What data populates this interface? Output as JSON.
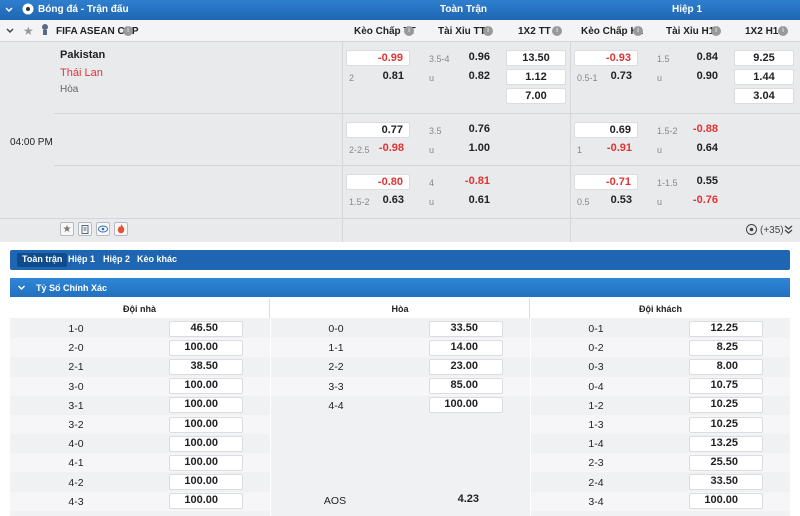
{
  "header": {
    "sport_title": "Bóng đá - Trận đấu",
    "full_match": "Toàn Trận",
    "half1": "Hiệp 1"
  },
  "columns": [
    "Kèo Chấp TT",
    "Tài Xỉu TT",
    "1X2 TT",
    "Kèo Chấp H1",
    "Tài Xỉu H1",
    "1X2 H1"
  ],
  "competition": "FIFA ASEAN CUP",
  "match": {
    "home": "Pakistan",
    "away": "Thái Lan",
    "draw": "Hòa",
    "time": "04:00 PM",
    "more": "(+35)"
  },
  "odds": {
    "r1": {
      "hc_tt_top": "-0.99",
      "hc_tt_lbl": "2",
      "hc_tt_bot": "0.81",
      "ou_tt_lbl_top": "3.5-4",
      "ou_tt_top": "0.96",
      "ou_tt_lbl_bot": "u",
      "ou_tt_bot": "0.82",
      "x_tt_1": "13.50",
      "x_tt_2": "1.12",
      "x_tt_3": "7.00",
      "hc_h1_top": "-0.93",
      "hc_h1_lbl": "0.5-1",
      "hc_h1_bot": "0.73",
      "ou_h1_lbl_top": "1.5",
      "ou_h1_top": "0.84",
      "ou_h1_lbl_bot": "u",
      "ou_h1_bot": "0.90",
      "x_h1_1": "9.25",
      "x_h1_2": "1.44",
      "x_h1_3": "3.04"
    },
    "r2": {
      "hc_tt_top": "0.77",
      "hc_tt_lbl": "2-2.5",
      "hc_tt_bot": "-0.98",
      "ou_tt_lbl_top": "3.5",
      "ou_tt_top": "0.76",
      "ou_tt_lbl_bot": "u",
      "ou_tt_bot": "1.00",
      "hc_h1_top": "0.69",
      "hc_h1_lbl": "1",
      "hc_h1_bot": "-0.91",
      "ou_h1_lbl_top": "1.5-2",
      "ou_h1_top": "-0.88",
      "ou_h1_lbl_bot": "u",
      "ou_h1_bot": "0.64"
    },
    "r3": {
      "hc_tt_top": "-0.80",
      "hc_tt_lbl": "1.5-2",
      "hc_tt_bot": "0.63",
      "ou_tt_lbl_top": "4",
      "ou_tt_top": "-0.81",
      "ou_tt_lbl_bot": "u",
      "ou_tt_bot": "0.61",
      "hc_h1_top": "-0.71",
      "hc_h1_lbl": "0.5",
      "hc_h1_bot": "0.53",
      "ou_h1_lbl_top": "1-1.5",
      "ou_h1_top": "0.55",
      "ou_h1_lbl_bot": "u",
      "ou_h1_bot": "-0.76"
    }
  },
  "tabs": [
    "Toàn trận",
    "Hiệp 1",
    "Hiệp 2",
    "Kèo khác"
  ],
  "section_title": "Tỷ Số Chính Xác",
  "cs_headers": {
    "home": "Đội nhà",
    "draw": "Hòa",
    "away": "Đội khách"
  },
  "cs_home": [
    [
      "1-0",
      "46.50"
    ],
    [
      "2-0",
      "100.00"
    ],
    [
      "2-1",
      "38.50"
    ],
    [
      "3-0",
      "100.00"
    ],
    [
      "3-1",
      "100.00"
    ],
    [
      "3-2",
      "100.00"
    ],
    [
      "4-0",
      "100.00"
    ],
    [
      "4-1",
      "100.00"
    ],
    [
      "4-2",
      "100.00"
    ],
    [
      "4-3",
      "100.00"
    ]
  ],
  "cs_draw": [
    [
      "0-0",
      "33.50"
    ],
    [
      "1-1",
      "14.00"
    ],
    [
      "2-2",
      "23.00"
    ],
    [
      "3-3",
      "85.00"
    ],
    [
      "4-4",
      "100.00"
    ]
  ],
  "cs_aos": [
    "AOS",
    "4.23"
  ],
  "cs_away": [
    [
      "0-1",
      "12.25"
    ],
    [
      "0-2",
      "8.25"
    ],
    [
      "0-3",
      "8.00"
    ],
    [
      "0-4",
      "10.75"
    ],
    [
      "1-2",
      "10.25"
    ],
    [
      "1-3",
      "10.25"
    ],
    [
      "1-4",
      "13.25"
    ],
    [
      "2-3",
      "25.50"
    ],
    [
      "2-4",
      "33.50"
    ],
    [
      "3-4",
      "100.00"
    ]
  ]
}
